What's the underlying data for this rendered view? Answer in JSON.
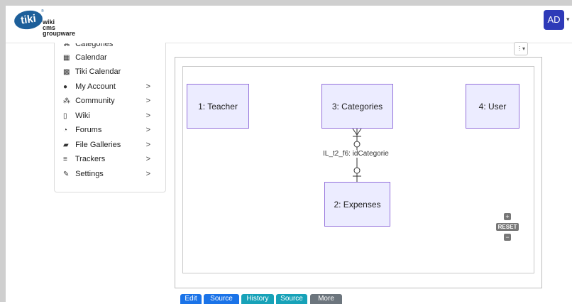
{
  "header": {
    "logo": {
      "badge": "tiki",
      "trademark": "®",
      "lines": [
        "wiki",
        "cms",
        "groupware"
      ]
    },
    "avatar_initials": "AD",
    "avatar_caret": "▾"
  },
  "sidebar": {
    "items": [
      {
        "label": "Categories",
        "icon": "tag-icon",
        "glyph": "⌘",
        "has_submenu": false
      },
      {
        "label": "Calendar",
        "icon": "calendar-icon",
        "glyph": "▦",
        "has_submenu": false
      },
      {
        "label": "Tiki Calendar",
        "icon": "calendar-solid-icon",
        "glyph": "▩",
        "has_submenu": false
      },
      {
        "label": "My Account",
        "icon": "user-icon",
        "glyph": "●",
        "has_submenu": true
      },
      {
        "label": "Community",
        "icon": "users-icon",
        "glyph": "⁂",
        "has_submenu": true
      },
      {
        "label": "Wiki",
        "icon": "file-icon",
        "glyph": "▯",
        "has_submenu": true
      },
      {
        "label": "Forums",
        "icon": "comments-icon",
        "glyph": "◔",
        "has_submenu": true
      },
      {
        "label": "File Galleries",
        "icon": "folder-icon",
        "glyph": "▰",
        "has_submenu": true
      },
      {
        "label": "Trackers",
        "icon": "database-icon",
        "glyph": "≡",
        "has_submenu": true
      },
      {
        "label": "Settings",
        "icon": "wrench-icon",
        "glyph": "✎",
        "has_submenu": true
      }
    ],
    "chevron": ">"
  },
  "diagram": {
    "toolbar_glyph": "⋮▾",
    "entities": {
      "teacher": "1: Teacher",
      "categories": "3: Categories",
      "user": "4: User",
      "expenses": "2: Expenses"
    },
    "relation_label": "IL_t2_f6: idCategorie",
    "zoom": {
      "plus": "+",
      "reset": "RESET",
      "minus": "−"
    },
    "entity_fill": "#ececff",
    "entity_stroke": "#9370db"
  },
  "actions": [
    {
      "label": "Edit",
      "color": "#1a73e8"
    },
    {
      "label": "Source",
      "color": "#1a73e8"
    },
    {
      "label": "History",
      "color": "#17a2b8"
    },
    {
      "label": "Source",
      "color": "#17a2b8"
    },
    {
      "label": "More",
      "color": "#6c757d"
    }
  ]
}
